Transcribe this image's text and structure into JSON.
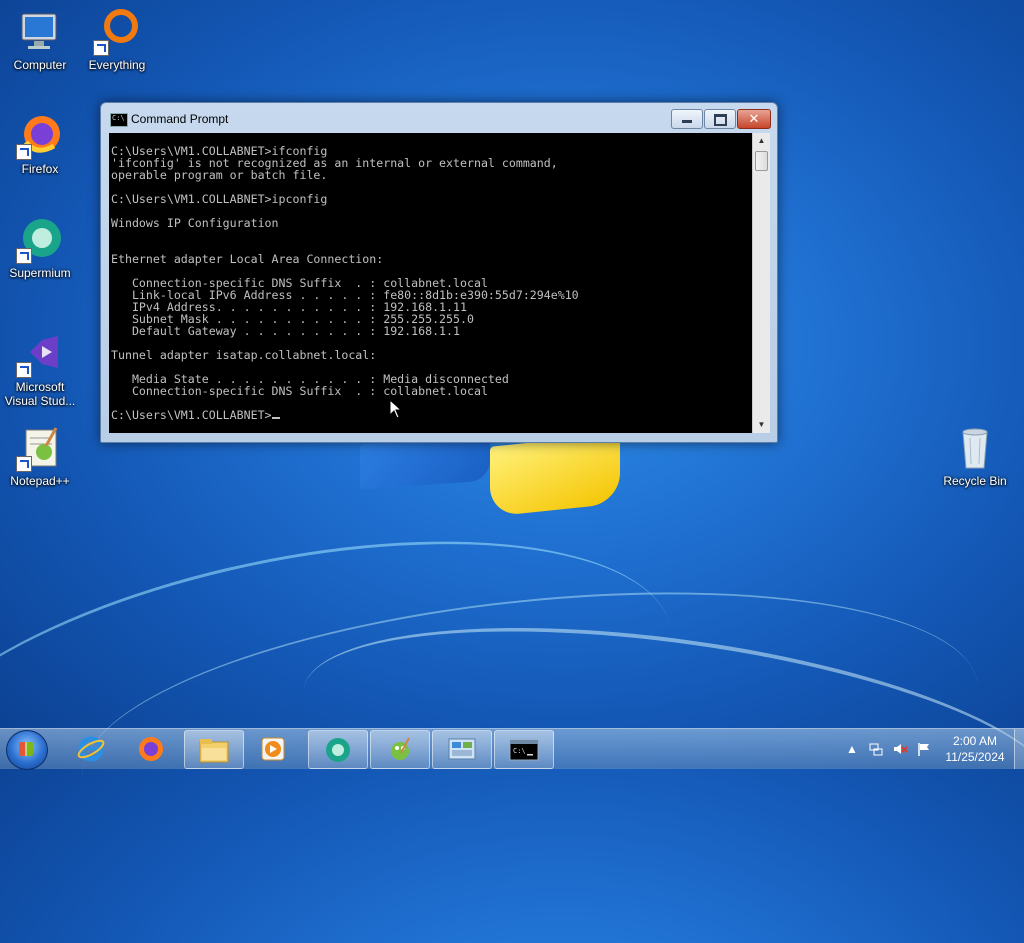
{
  "desktop": {
    "icons": [
      {
        "label": "Computer"
      },
      {
        "label": "Everything"
      },
      {
        "label": "Firefox"
      },
      {
        "label": "Supermium"
      },
      {
        "label": "Microsoft Visual Stud..."
      },
      {
        "label": "Notepad++"
      },
      {
        "label": "Recycle Bin"
      }
    ]
  },
  "window": {
    "title": "Command Prompt",
    "console_text": "C:\\Users\\VM1.COLLABNET>ifconfig\n'ifconfig' is not recognized as an internal or external command,\noperable program or batch file.\n\nC:\\Users\\VM1.COLLABNET>ipconfig\n\nWindows IP Configuration\n\n\nEthernet adapter Local Area Connection:\n\n   Connection-specific DNS Suffix  . : collabnet.local\n   Link-local IPv6 Address . . . . . : fe80::8d1b:e390:55d7:294e%10\n   IPv4 Address. . . . . . . . . . . : 192.168.1.11\n   Subnet Mask . . . . . . . . . . . : 255.255.255.0\n   Default Gateway . . . . . . . . . : 192.168.1.1\n\nTunnel adapter isatap.collabnet.local:\n\n   Media State . . . . . . . . . . . : Media disconnected\n   Connection-specific DNS Suffix  . : collabnet.local\n\n",
    "prompt": "C:\\Users\\VM1.COLLABNET>"
  },
  "taskbar": {
    "items": [
      "internet-explorer",
      "firefox",
      "file-explorer",
      "media-player",
      "supermium",
      "notepad-plus-plus",
      "control-panel",
      "command-prompt"
    ],
    "clock": {
      "time": "2:00 AM",
      "date": "11/25/2024"
    }
  },
  "colors": {
    "console_bg": "#000000",
    "console_fg": "#c0c0c0",
    "desktop": "#1f6fd0"
  }
}
